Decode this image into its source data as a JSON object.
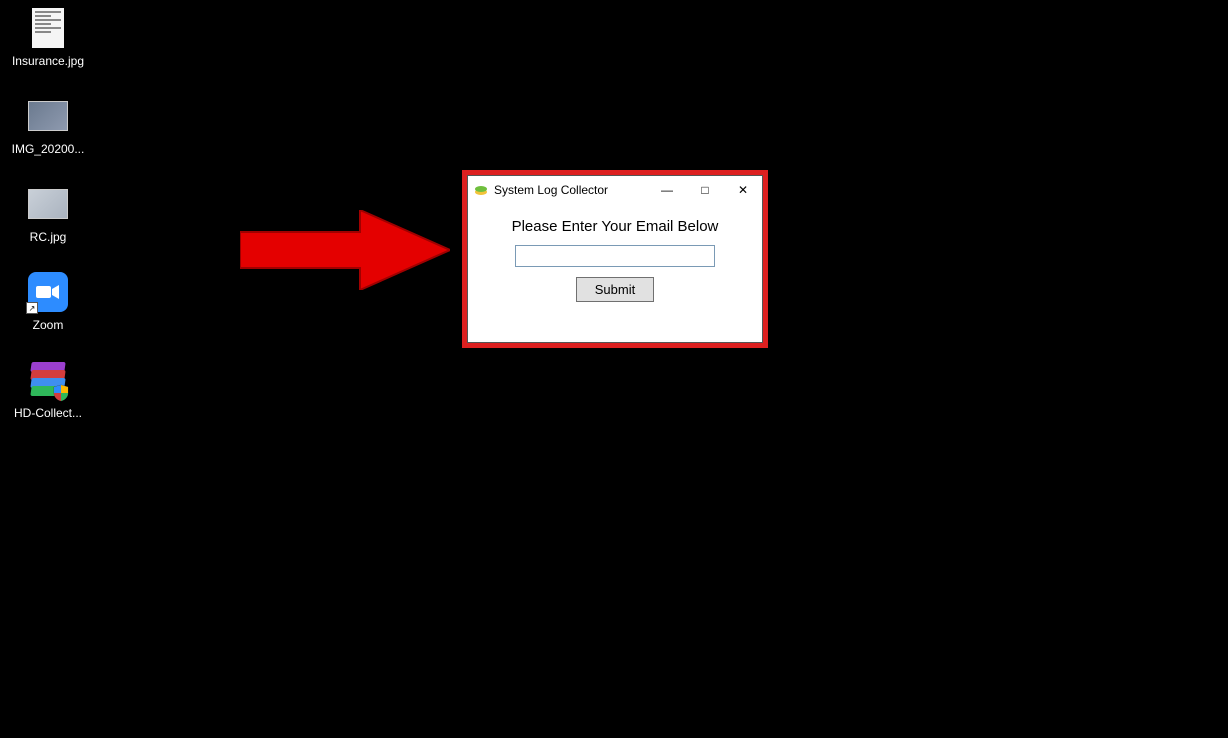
{
  "desktop": {
    "icons": [
      {
        "label": "Insurance.jpg",
        "name": "desktop-icon-insurance"
      },
      {
        "label": "IMG_20200...",
        "name": "desktop-icon-img"
      },
      {
        "label": "RC.jpg",
        "name": "desktop-icon-rc"
      },
      {
        "label": "Zoom",
        "name": "desktop-icon-zoom"
      },
      {
        "label": "HD-Collect...",
        "name": "desktop-icon-hdcollect"
      }
    ]
  },
  "dialog": {
    "title": "System Log Collector",
    "prompt": "Please Enter Your Email Below",
    "email_value": "",
    "submit_label": "Submit"
  },
  "window_controls": {
    "minimize": "—",
    "maximize": "□",
    "close": "✕"
  }
}
